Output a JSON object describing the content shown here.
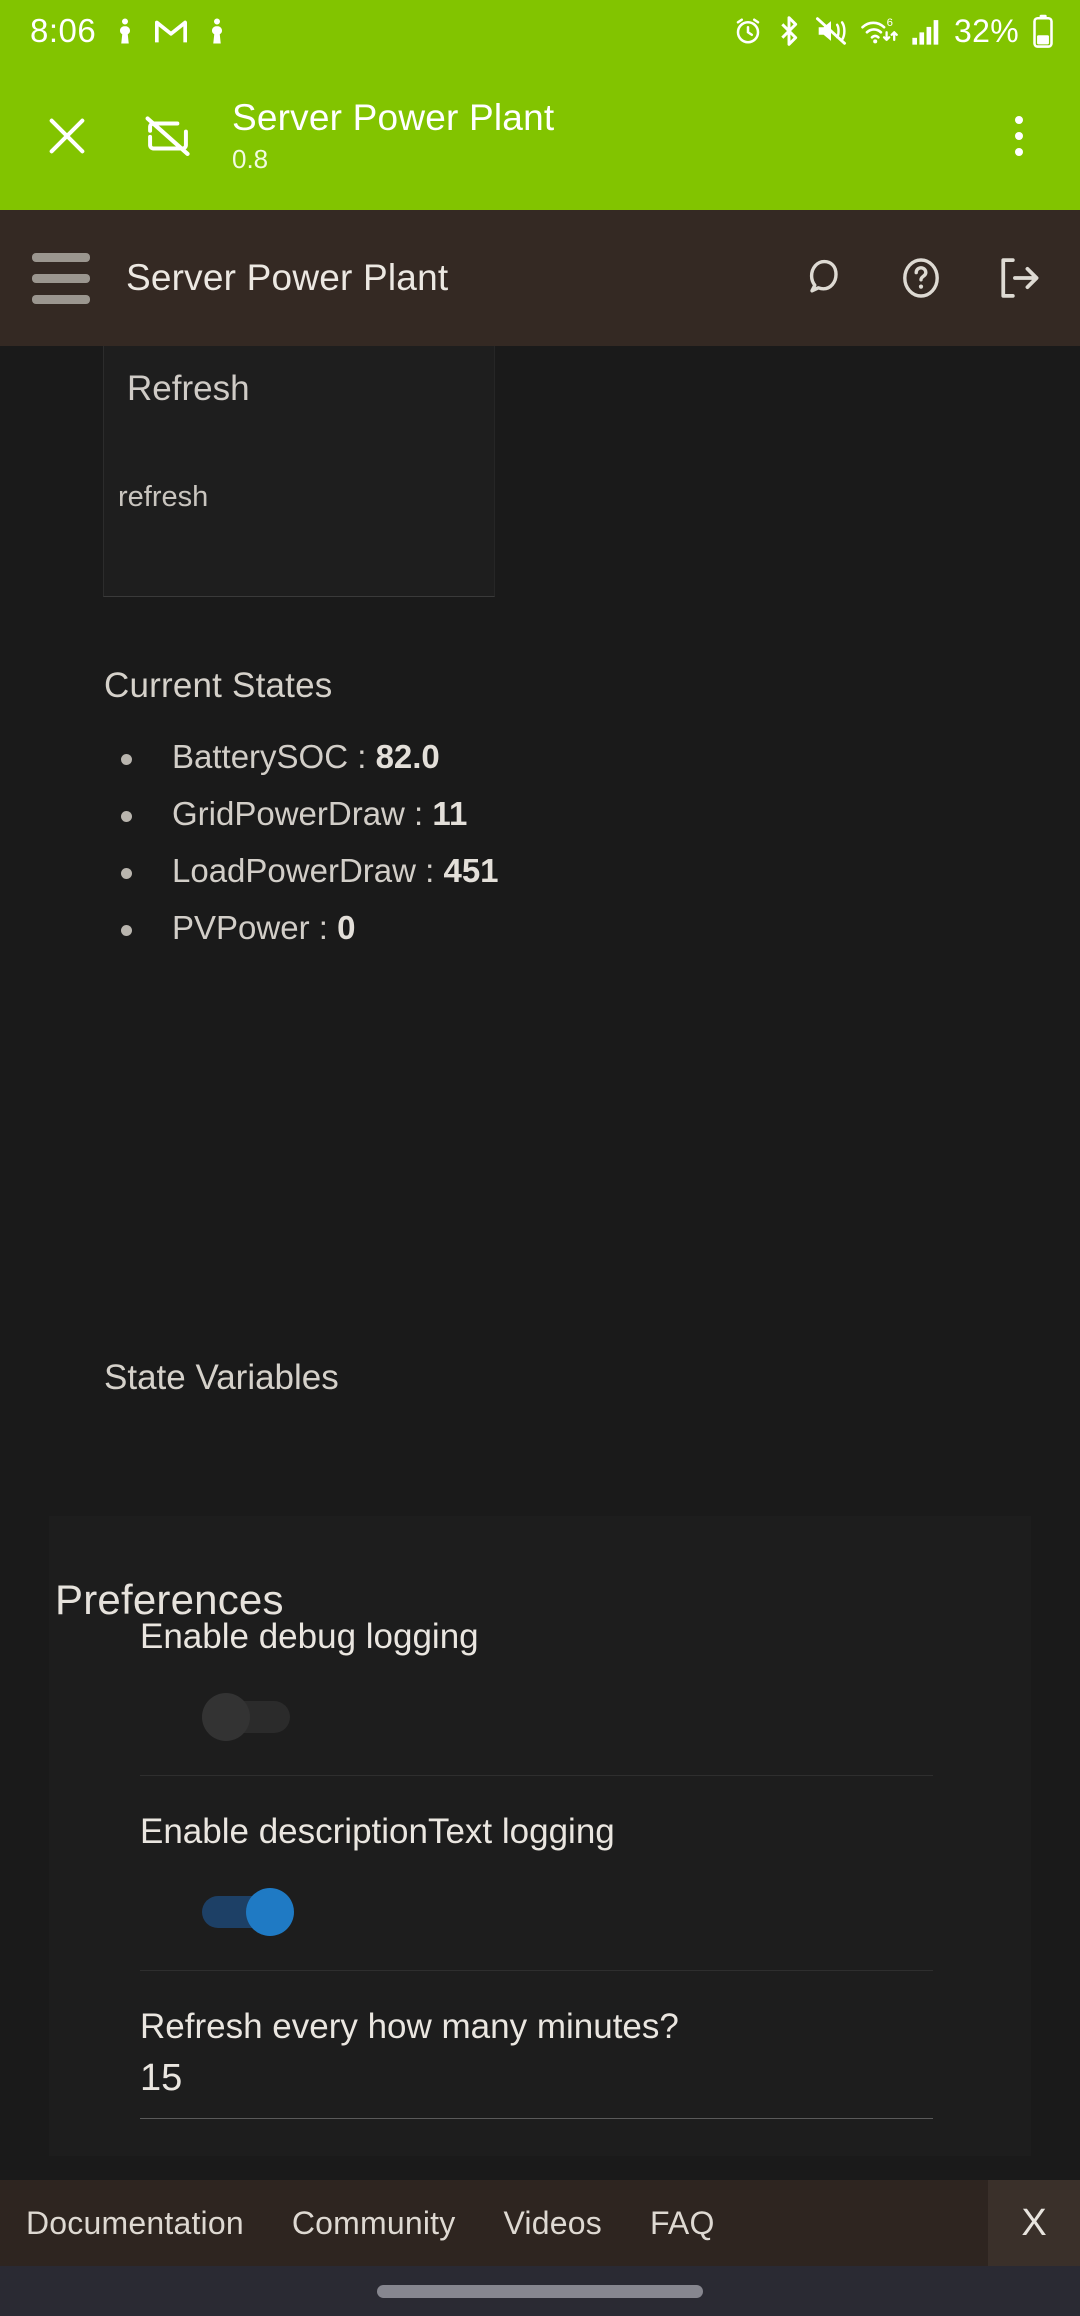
{
  "status_bar": {
    "time": "8:06",
    "battery_percent": "32%",
    "left_icons": [
      "app-icon",
      "gmail-icon",
      "app-icon"
    ],
    "right_icons": [
      "alarm-icon",
      "bluetooth-icon",
      "vibrate-mute-icon",
      "wifi-6-icon",
      "cellular-signal-icon",
      "battery-icon"
    ],
    "accent_color": "#82c400"
  },
  "green_bar": {
    "close_icon": "close-icon",
    "cast_icon": "cast-disabled-icon",
    "title": "Server Power Plant",
    "subtitle": "0.8",
    "overflow_icon": "more-vertical-icon",
    "background": "#82c400"
  },
  "app_header": {
    "menu_icon": "hamburger-menu-icon",
    "title": "Server Power Plant",
    "icons": [
      {
        "name": "chat-bubble-icon"
      },
      {
        "name": "help-circle-icon"
      },
      {
        "name": "logout-icon"
      }
    ],
    "background": "#342923"
  },
  "command_card": {
    "title": "Refresh",
    "action_label": "refresh"
  },
  "current_states": {
    "heading": "Current States",
    "items": [
      {
        "label": "BatterySOC :",
        "value": "82.0"
      },
      {
        "label": "GridPowerDraw :",
        "value": "11"
      },
      {
        "label": "LoadPowerDraw :",
        "value": "451"
      },
      {
        "label": "PVPower :",
        "value": "0"
      }
    ]
  },
  "state_variables": {
    "heading": "State Variables"
  },
  "preferences": {
    "heading": "Preferences",
    "rows": [
      {
        "label": "Enable debug logging",
        "type": "toggle",
        "state": "off"
      },
      {
        "label": "Enable descriptionText logging",
        "type": "toggle",
        "state": "on",
        "color": "#1f7ac4"
      },
      {
        "label": "Refresh every how many minutes?",
        "type": "text",
        "value": "15"
      }
    ]
  },
  "footer": {
    "links": [
      "Documentation",
      "Community",
      "Videos",
      "FAQ"
    ],
    "close_label": "X"
  },
  "nav_bar": {
    "handle": "home-gesture-pill"
  }
}
